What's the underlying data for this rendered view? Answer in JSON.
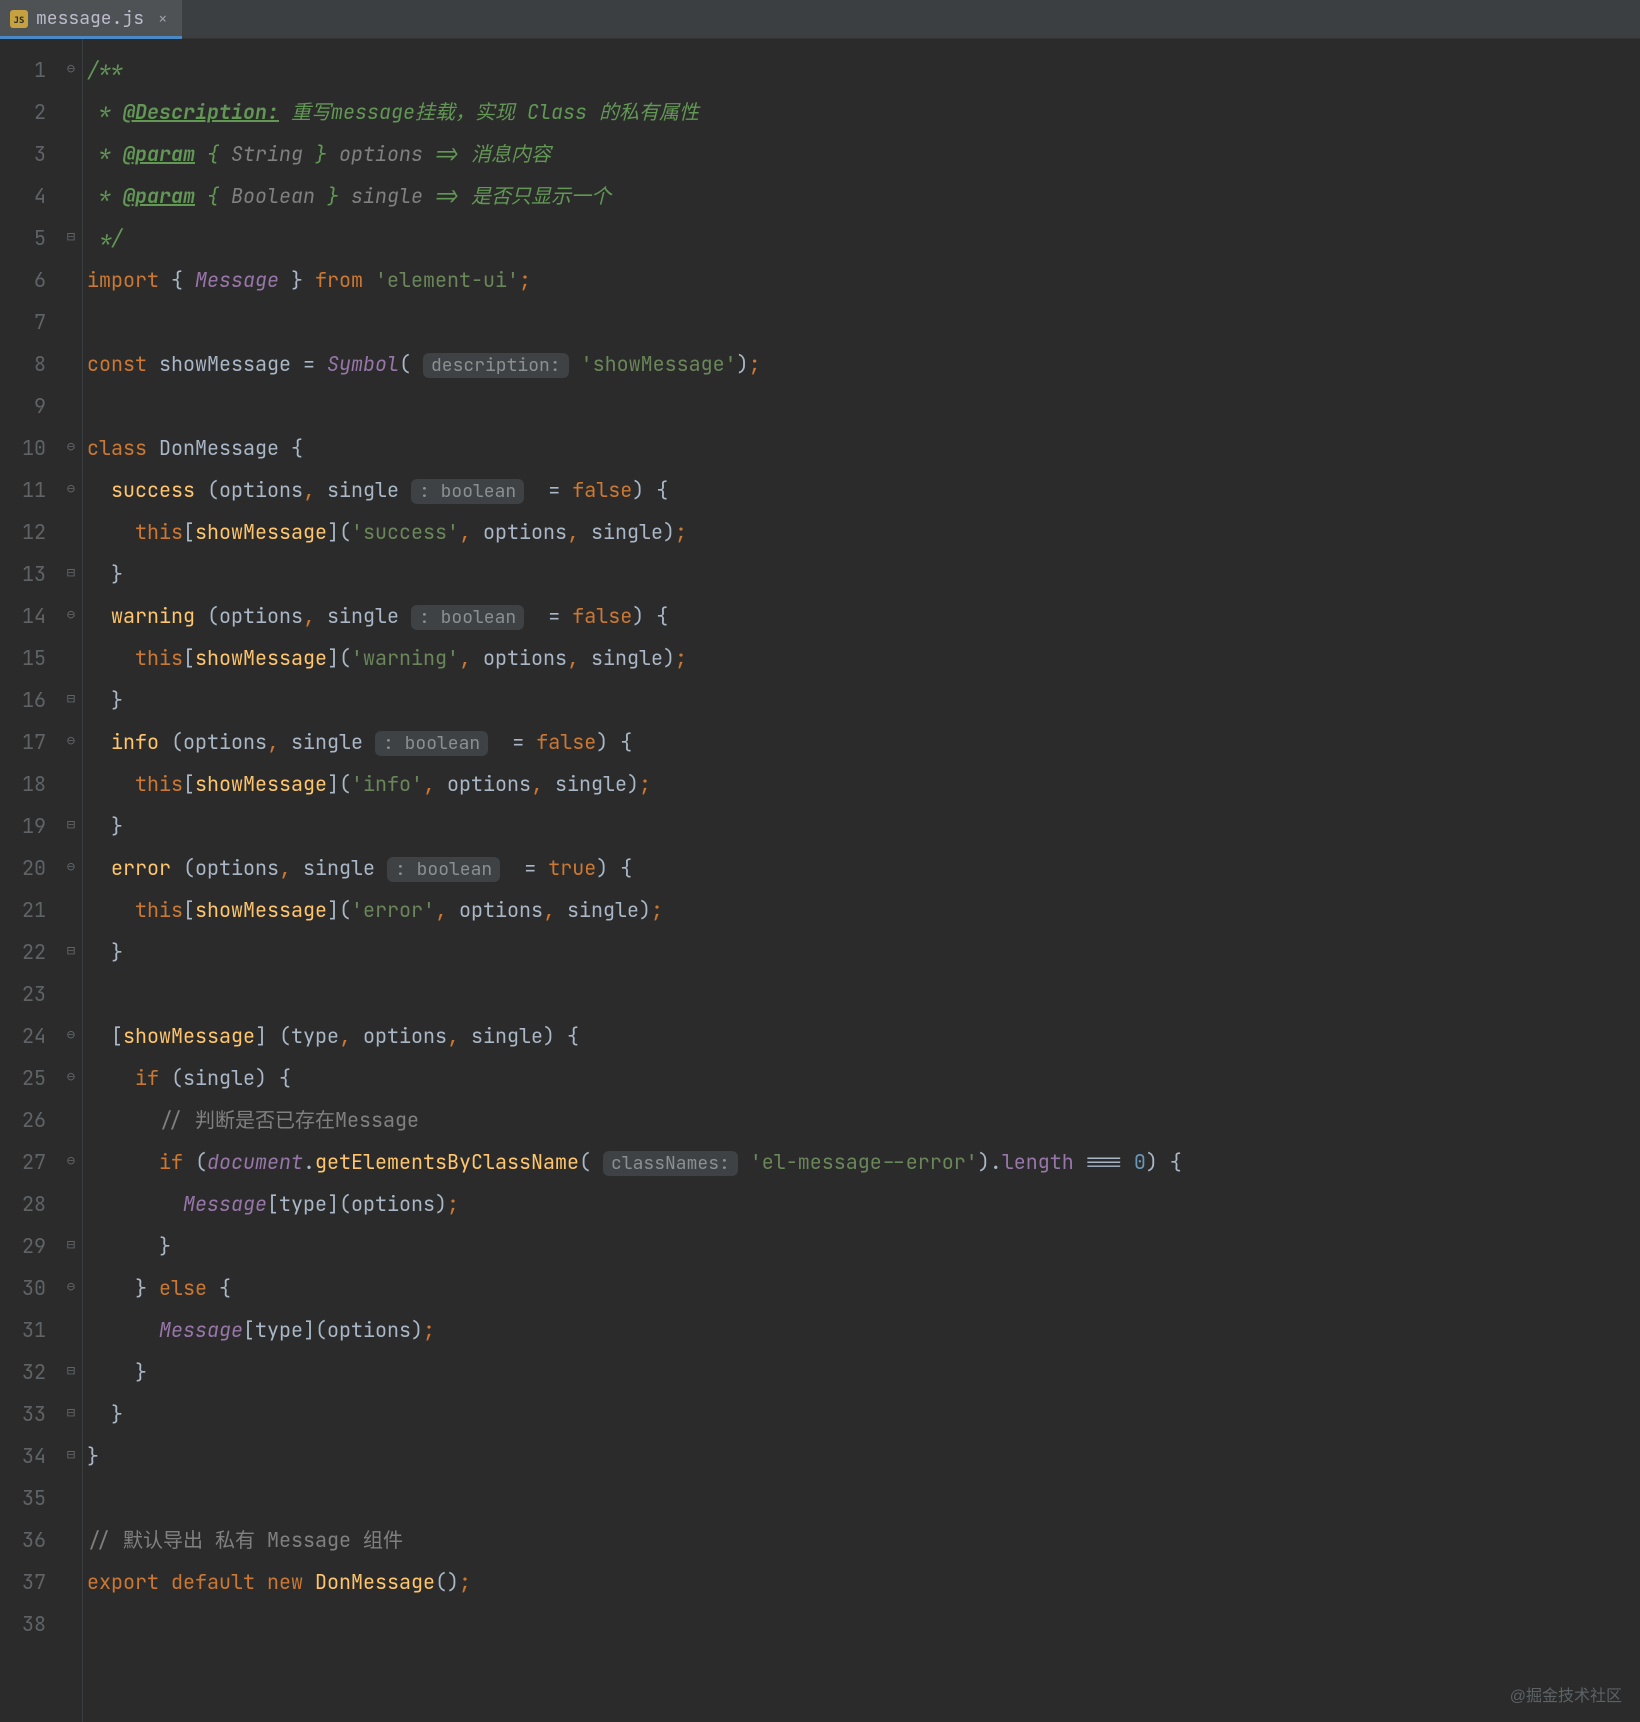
{
  "tab": {
    "filename": "message.js",
    "icon_label": "JS"
  },
  "lines": [
    {
      "n": 1,
      "fold": "⊖",
      "tokens": [
        {
          "t": "/**",
          "c": "c-doc"
        }
      ]
    },
    {
      "n": 2,
      "fold": "",
      "tokens": [
        {
          "t": " * ",
          "c": "c-doc"
        },
        {
          "t": "@Description:",
          "c": "c-doc-tag"
        },
        {
          "t": " 重写message挂载，实现 ",
          "c": "c-doc"
        },
        {
          "t": "Class",
          "c": "c-doc"
        },
        {
          "t": " 的私有属性",
          "c": "c-doc"
        }
      ]
    },
    {
      "n": 3,
      "fold": "",
      "tokens": [
        {
          "t": " * ",
          "c": "c-doc"
        },
        {
          "t": "@param",
          "c": "c-doc-tag"
        },
        {
          "t": " { ",
          "c": "c-doc"
        },
        {
          "t": "String",
          "c": "c-doc-type c-italic"
        },
        {
          "t": " } ",
          "c": "c-doc"
        },
        {
          "t": "options",
          "c": "c-doc-name c-italic"
        },
        {
          "t": " => 消息内容",
          "c": "c-doc"
        }
      ]
    },
    {
      "n": 4,
      "fold": "",
      "tokens": [
        {
          "t": " * ",
          "c": "c-doc"
        },
        {
          "t": "@param",
          "c": "c-doc-tag"
        },
        {
          "t": " { ",
          "c": "c-doc"
        },
        {
          "t": "Boolean",
          "c": "c-doc-type c-italic"
        },
        {
          "t": " } ",
          "c": "c-doc"
        },
        {
          "t": "single",
          "c": "c-doc-name c-italic"
        },
        {
          "t": " => 是否只显示一个",
          "c": "c-doc"
        }
      ]
    },
    {
      "n": 5,
      "fold": "⊟",
      "tokens": [
        {
          "t": " */",
          "c": "c-doc"
        }
      ]
    },
    {
      "n": 6,
      "fold": "",
      "tokens": [
        {
          "t": "import ",
          "c": "c-keyword"
        },
        {
          "t": "{ ",
          "c": "c-brace"
        },
        {
          "t": "Message",
          "c": "c-purple"
        },
        {
          "t": " } ",
          "c": "c-brace"
        },
        {
          "t": "from ",
          "c": "c-keyword"
        },
        {
          "t": "'element-ui'",
          "c": "c-string"
        },
        {
          "t": ";",
          "c": "c-keyword"
        }
      ]
    },
    {
      "n": 7,
      "fold": "",
      "tokens": []
    },
    {
      "n": 8,
      "fold": "",
      "tokens": [
        {
          "t": "const ",
          "c": "c-keyword"
        },
        {
          "t": "showMessage ",
          "c": "c-ident"
        },
        {
          "t": "= ",
          "c": "c-punct"
        },
        {
          "t": "Symbol",
          "c": "c-purple"
        },
        {
          "t": "( ",
          "c": "c-punct"
        },
        {
          "t": "description:",
          "c": "c-hint-pill"
        },
        {
          "t": " ",
          "c": ""
        },
        {
          "t": "'showMessage'",
          "c": "c-string"
        },
        {
          "t": ")",
          "c": "c-punct"
        },
        {
          "t": ";",
          "c": "c-keyword"
        }
      ]
    },
    {
      "n": 9,
      "fold": "",
      "tokens": []
    },
    {
      "n": 10,
      "fold": "⊖",
      "tokens": [
        {
          "t": "class ",
          "c": "c-keyword"
        },
        {
          "t": "DonMessage ",
          "c": "c-class"
        },
        {
          "t": "{",
          "c": "c-brace"
        }
      ]
    },
    {
      "n": 11,
      "fold": "⊖",
      "tokens": [
        {
          "t": "  ",
          "c": ""
        },
        {
          "t": "success ",
          "c": "c-func"
        },
        {
          "t": "(options",
          "c": "c-punct"
        },
        {
          "t": ", ",
          "c": "c-keyword"
        },
        {
          "t": "single ",
          "c": "c-punct"
        },
        {
          "t": ": boolean",
          "c": "c-hint-pill"
        },
        {
          "t": "  = ",
          "c": "c-punct"
        },
        {
          "t": "false",
          "c": "c-keyword"
        },
        {
          "t": ") {",
          "c": "c-brace"
        }
      ]
    },
    {
      "n": 12,
      "fold": "",
      "tokens": [
        {
          "t": "    ",
          "c": ""
        },
        {
          "t": "this",
          "c": "c-keyword"
        },
        {
          "t": "[",
          "c": "c-punct"
        },
        {
          "t": "showMessage",
          "c": "c-func"
        },
        {
          "t": "](",
          "c": "c-punct"
        },
        {
          "t": "'success'",
          "c": "c-string"
        },
        {
          "t": ", ",
          "c": "c-keyword"
        },
        {
          "t": "options",
          "c": "c-ident"
        },
        {
          "t": ", ",
          "c": "c-keyword"
        },
        {
          "t": "single)",
          "c": "c-ident"
        },
        {
          "t": ";",
          "c": "c-keyword"
        }
      ]
    },
    {
      "n": 13,
      "fold": "⊟",
      "tokens": [
        {
          "t": "  }",
          "c": "c-brace"
        }
      ]
    },
    {
      "n": 14,
      "fold": "⊖",
      "tokens": [
        {
          "t": "  ",
          "c": ""
        },
        {
          "t": "warning ",
          "c": "c-func"
        },
        {
          "t": "(options",
          "c": "c-punct"
        },
        {
          "t": ", ",
          "c": "c-keyword"
        },
        {
          "t": "single ",
          "c": "c-punct"
        },
        {
          "t": ": boolean",
          "c": "c-hint-pill"
        },
        {
          "t": "  = ",
          "c": "c-punct"
        },
        {
          "t": "false",
          "c": "c-keyword"
        },
        {
          "t": ") {",
          "c": "c-brace"
        }
      ]
    },
    {
      "n": 15,
      "fold": "",
      "tokens": [
        {
          "t": "    ",
          "c": ""
        },
        {
          "t": "this",
          "c": "c-keyword"
        },
        {
          "t": "[",
          "c": "c-punct"
        },
        {
          "t": "showMessage",
          "c": "c-func"
        },
        {
          "t": "](",
          "c": "c-punct"
        },
        {
          "t": "'warning'",
          "c": "c-string"
        },
        {
          "t": ", ",
          "c": "c-keyword"
        },
        {
          "t": "options",
          "c": "c-ident"
        },
        {
          "t": ", ",
          "c": "c-keyword"
        },
        {
          "t": "single)",
          "c": "c-ident"
        },
        {
          "t": ";",
          "c": "c-keyword"
        }
      ]
    },
    {
      "n": 16,
      "fold": "⊟",
      "tokens": [
        {
          "t": "  }",
          "c": "c-brace"
        }
      ]
    },
    {
      "n": 17,
      "fold": "⊖",
      "tokens": [
        {
          "t": "  ",
          "c": ""
        },
        {
          "t": "info ",
          "c": "c-func"
        },
        {
          "t": "(options",
          "c": "c-punct"
        },
        {
          "t": ", ",
          "c": "c-keyword"
        },
        {
          "t": "single ",
          "c": "c-punct"
        },
        {
          "t": ": boolean",
          "c": "c-hint-pill"
        },
        {
          "t": "  = ",
          "c": "c-punct"
        },
        {
          "t": "false",
          "c": "c-keyword"
        },
        {
          "t": ") {",
          "c": "c-brace"
        }
      ]
    },
    {
      "n": 18,
      "fold": "",
      "tokens": [
        {
          "t": "    ",
          "c": ""
        },
        {
          "t": "this",
          "c": "c-keyword"
        },
        {
          "t": "[",
          "c": "c-punct"
        },
        {
          "t": "showMessage",
          "c": "c-func"
        },
        {
          "t": "](",
          "c": "c-punct"
        },
        {
          "t": "'info'",
          "c": "c-string"
        },
        {
          "t": ", ",
          "c": "c-keyword"
        },
        {
          "t": "options",
          "c": "c-ident"
        },
        {
          "t": ", ",
          "c": "c-keyword"
        },
        {
          "t": "single)",
          "c": "c-ident"
        },
        {
          "t": ";",
          "c": "c-keyword"
        }
      ]
    },
    {
      "n": 19,
      "fold": "⊟",
      "tokens": [
        {
          "t": "  }",
          "c": "c-brace"
        }
      ]
    },
    {
      "n": 20,
      "fold": "⊖",
      "tokens": [
        {
          "t": "  ",
          "c": ""
        },
        {
          "t": "error ",
          "c": "c-func"
        },
        {
          "t": "(options",
          "c": "c-punct"
        },
        {
          "t": ", ",
          "c": "c-keyword"
        },
        {
          "t": "single ",
          "c": "c-punct"
        },
        {
          "t": ": boolean",
          "c": "c-hint-pill"
        },
        {
          "t": "  = ",
          "c": "c-punct"
        },
        {
          "t": "true",
          "c": "c-keyword"
        },
        {
          "t": ") {",
          "c": "c-brace"
        }
      ]
    },
    {
      "n": 21,
      "fold": "",
      "tokens": [
        {
          "t": "    ",
          "c": ""
        },
        {
          "t": "this",
          "c": "c-keyword"
        },
        {
          "t": "[",
          "c": "c-punct"
        },
        {
          "t": "showMessage",
          "c": "c-func"
        },
        {
          "t": "](",
          "c": "c-punct"
        },
        {
          "t": "'error'",
          "c": "c-string"
        },
        {
          "t": ", ",
          "c": "c-keyword"
        },
        {
          "t": "options",
          "c": "c-ident"
        },
        {
          "t": ", ",
          "c": "c-keyword"
        },
        {
          "t": "single)",
          "c": "c-ident"
        },
        {
          "t": ";",
          "c": "c-keyword"
        }
      ]
    },
    {
      "n": 22,
      "fold": "⊟",
      "tokens": [
        {
          "t": "  }",
          "c": "c-brace"
        }
      ]
    },
    {
      "n": 23,
      "fold": "",
      "tokens": []
    },
    {
      "n": 24,
      "fold": "⊖",
      "tokens": [
        {
          "t": "  [",
          "c": "c-punct"
        },
        {
          "t": "showMessage",
          "c": "c-func"
        },
        {
          "t": "] (type",
          "c": "c-punct"
        },
        {
          "t": ", ",
          "c": "c-keyword"
        },
        {
          "t": "options",
          "c": "c-ident"
        },
        {
          "t": ", ",
          "c": "c-keyword"
        },
        {
          "t": "single) {",
          "c": "c-brace"
        }
      ]
    },
    {
      "n": 25,
      "fold": "⊖",
      "tokens": [
        {
          "t": "    ",
          "c": ""
        },
        {
          "t": "if ",
          "c": "c-keyword"
        },
        {
          "t": "(single) {",
          "c": "c-brace"
        }
      ]
    },
    {
      "n": 26,
      "fold": "",
      "tokens": [
        {
          "t": "      ",
          "c": ""
        },
        {
          "t": "// 判断是否已存在Message",
          "c": "c-comment"
        }
      ]
    },
    {
      "n": 27,
      "fold": "⊖",
      "tokens": [
        {
          "t": "      ",
          "c": ""
        },
        {
          "t": "if ",
          "c": "c-keyword"
        },
        {
          "t": "(",
          "c": "c-punct"
        },
        {
          "t": "document",
          "c": "c-purple"
        },
        {
          "t": ".",
          "c": "c-punct"
        },
        {
          "t": "getElementsByClassName",
          "c": "c-func"
        },
        {
          "t": "( ",
          "c": "c-punct"
        },
        {
          "t": "classNames:",
          "c": "c-hint-pill"
        },
        {
          "t": " ",
          "c": ""
        },
        {
          "t": "'el-message--error'",
          "c": "c-string"
        },
        {
          "t": ").",
          "c": "c-punct"
        },
        {
          "t": "length ",
          "c": "c-field"
        },
        {
          "t": "=== ",
          "c": "c-punct"
        },
        {
          "t": "0",
          "c": "c-number"
        },
        {
          "t": ") {",
          "c": "c-brace"
        }
      ]
    },
    {
      "n": 28,
      "fold": "",
      "tokens": [
        {
          "t": "        ",
          "c": ""
        },
        {
          "t": "Message",
          "c": "c-purple"
        },
        {
          "t": "[type](options)",
          "c": "c-punct"
        },
        {
          "t": ";",
          "c": "c-keyword"
        }
      ]
    },
    {
      "n": 29,
      "fold": "⊟",
      "tokens": [
        {
          "t": "      }",
          "c": "c-brace"
        }
      ]
    },
    {
      "n": 30,
      "fold": "⊖",
      "tokens": [
        {
          "t": "    } ",
          "c": "c-brace"
        },
        {
          "t": "else ",
          "c": "c-keyword"
        },
        {
          "t": "{",
          "c": "c-brace"
        }
      ]
    },
    {
      "n": 31,
      "fold": "",
      "tokens": [
        {
          "t": "      ",
          "c": ""
        },
        {
          "t": "Message",
          "c": "c-purple"
        },
        {
          "t": "[type](options)",
          "c": "c-punct"
        },
        {
          "t": ";",
          "c": "c-keyword"
        }
      ]
    },
    {
      "n": 32,
      "fold": "⊟",
      "tokens": [
        {
          "t": "    }",
          "c": "c-brace"
        }
      ]
    },
    {
      "n": 33,
      "fold": "⊟",
      "tokens": [
        {
          "t": "  }",
          "c": "c-brace"
        }
      ]
    },
    {
      "n": 34,
      "fold": "⊟",
      "tokens": [
        {
          "t": "}",
          "c": "c-brace"
        }
      ]
    },
    {
      "n": 35,
      "fold": "",
      "tokens": []
    },
    {
      "n": 36,
      "fold": "",
      "tokens": [
        {
          "t": "// 默认导出 私有 Message 组件",
          "c": "c-comment"
        }
      ]
    },
    {
      "n": 37,
      "fold": "",
      "tokens": [
        {
          "t": "export default new ",
          "c": "c-keyword"
        },
        {
          "t": "DonMessage",
          "c": "c-func"
        },
        {
          "t": "()",
          "c": "c-punct"
        },
        {
          "t": ";",
          "c": "c-keyword"
        }
      ]
    },
    {
      "n": 38,
      "fold": "",
      "tokens": []
    }
  ],
  "watermark": "@掘金技术社区"
}
